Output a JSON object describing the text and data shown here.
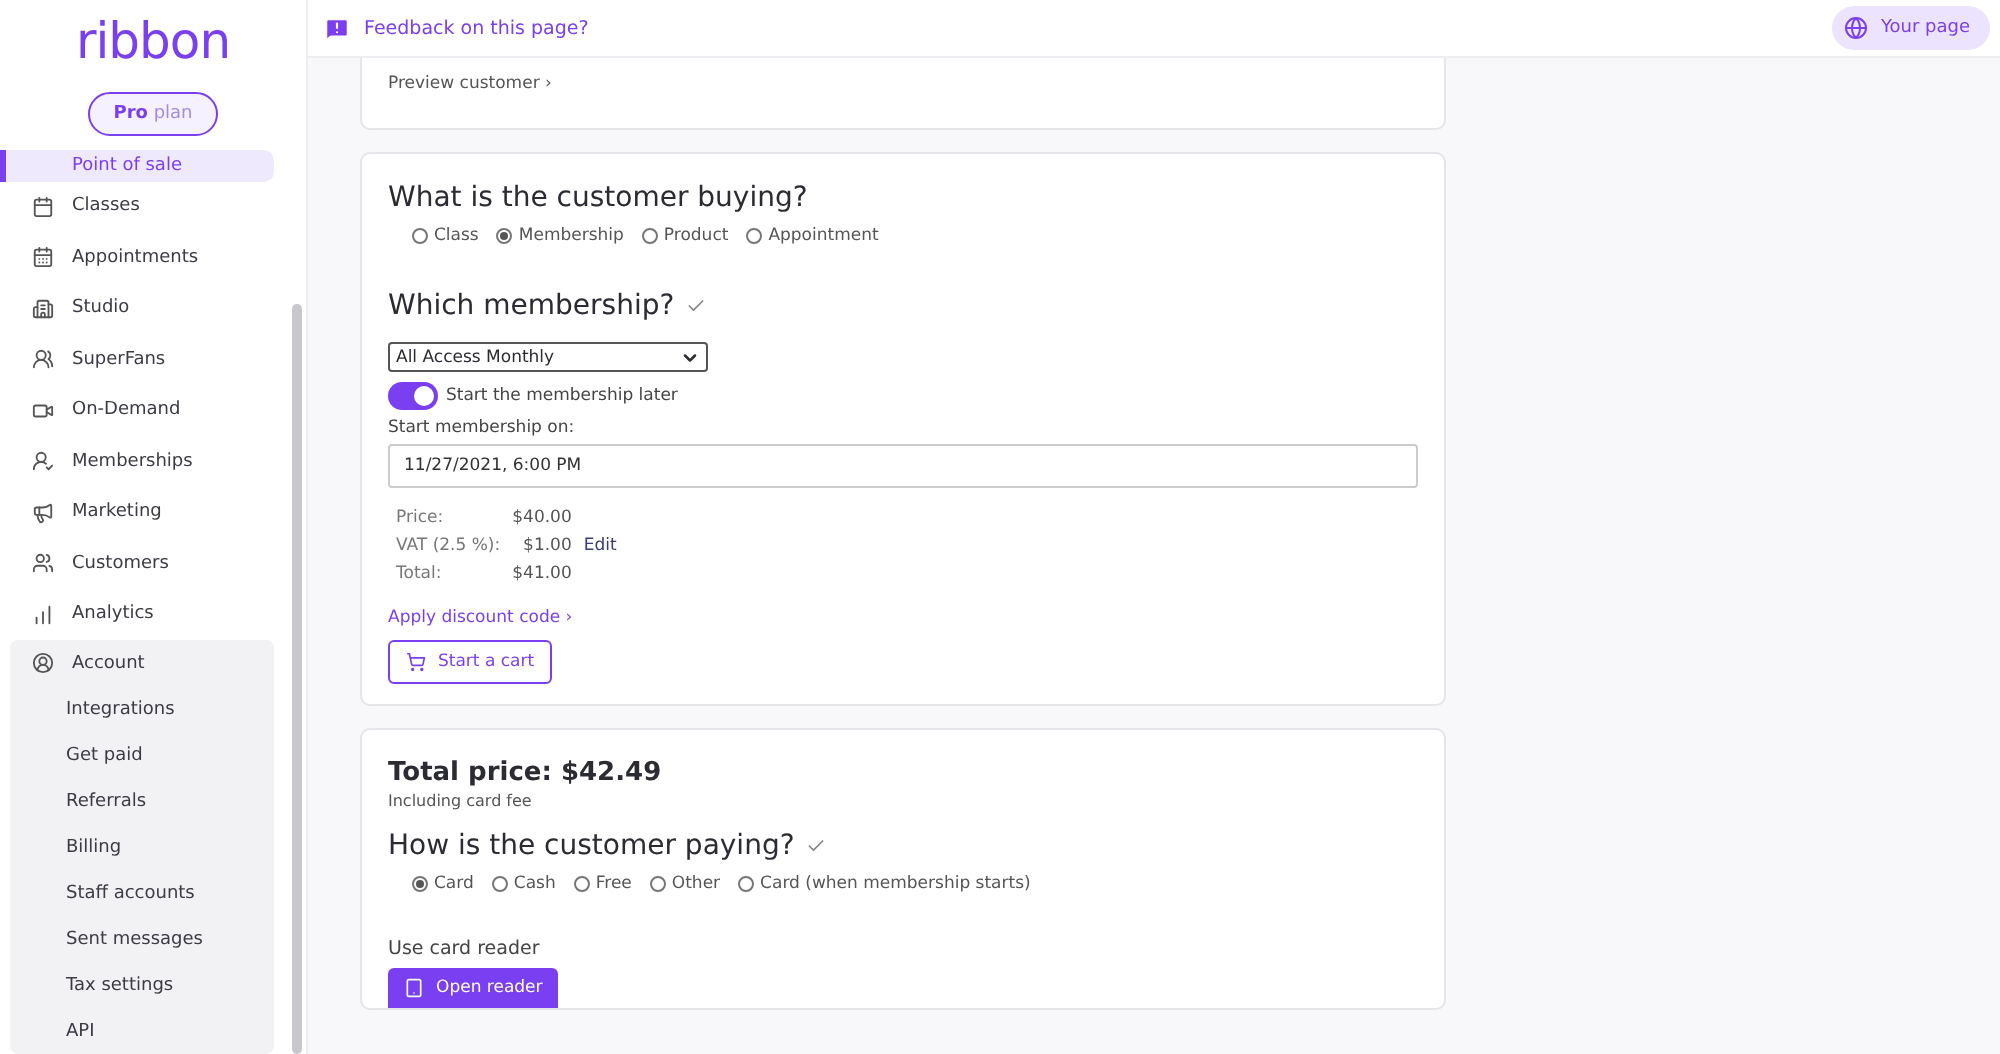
{
  "sidebar": {
    "logo": "ribbon",
    "plan": "**Pro** plan",
    "items": [
      {
        "label": "Point of sale",
        "selected": true
      },
      {
        "label": "Classes",
        "selected": false
      },
      {
        "label": "Appointments",
        "selected": false
      },
      {
        "label": "Studio",
        "selected": false
      },
      {
        "label": "SuperFans",
        "selected": false
      },
      {
        "label": "On-Demand",
        "selected": false
      },
      {
        "label": "Memberships",
        "selected": false
      },
      {
        "label": "Marketing",
        "selected": false
      },
      {
        "label": "Customers",
        "selected": false
      },
      {
        "label": "Analytics",
        "selected": false
      },
      {
        "label": "Account",
        "selected": false,
        "expanded": true,
        "children": [
          {
            "label": "Integrations"
          },
          {
            "label": "Get paid"
          },
          {
            "label": "Referrals"
          },
          {
            "label": "Billing"
          },
          {
            "label": "Staff accounts"
          },
          {
            "label": "Sent messages"
          },
          {
            "label": "Tax settings"
          },
          {
            "label": "API"
          }
        ]
      }
    ]
  },
  "top_bar": {
    "feedback": "Feedback on this page?",
    "your_page": "Your page"
  },
  "preview_link": "Preview customer ›",
  "purchase": {
    "title": "What is the customer buying?",
    "types": [
      {
        "label": "Class",
        "selected": false
      },
      {
        "label": "Membership",
        "selected": true
      },
      {
        "label": "Product",
        "selected": false
      },
      {
        "label": "Appointment",
        "selected": false
      }
    ],
    "membership_title": "Which membership?",
    "membership_done": true,
    "membership": "All Access Monthly",
    "start_later": {
      "label": "Start the membership later",
      "on": true
    },
    "start_label": "Start membership on:",
    "start_date": "11/27/2021, 6:00 PM",
    "price_rows": [
      {
        "label": "Price:",
        "value": "$40.00"
      },
      {
        "label": "VAT (2.5 %):",
        "value": "$1.00",
        "action": "Edit"
      },
      {
        "label": "Total:",
        "value": "$41.00"
      }
    ],
    "discount_link": "Apply discount code ›",
    "cart_button": "Start a cart"
  },
  "payment": {
    "total": "Total price: $42.49",
    "note": "Including card fee",
    "title": "How is the customer paying?",
    "title_done": true,
    "methods": [
      {
        "label": "Card",
        "selected": true
      },
      {
        "label": "Cash",
        "selected": false
      },
      {
        "label": "Free",
        "selected": false
      },
      {
        "label": "Other",
        "selected": false
      },
      {
        "label": "Card (when membership starts)",
        "selected": false
      }
    ],
    "reader_label": "Use card reader",
    "reader_button": "Open reader"
  }
}
